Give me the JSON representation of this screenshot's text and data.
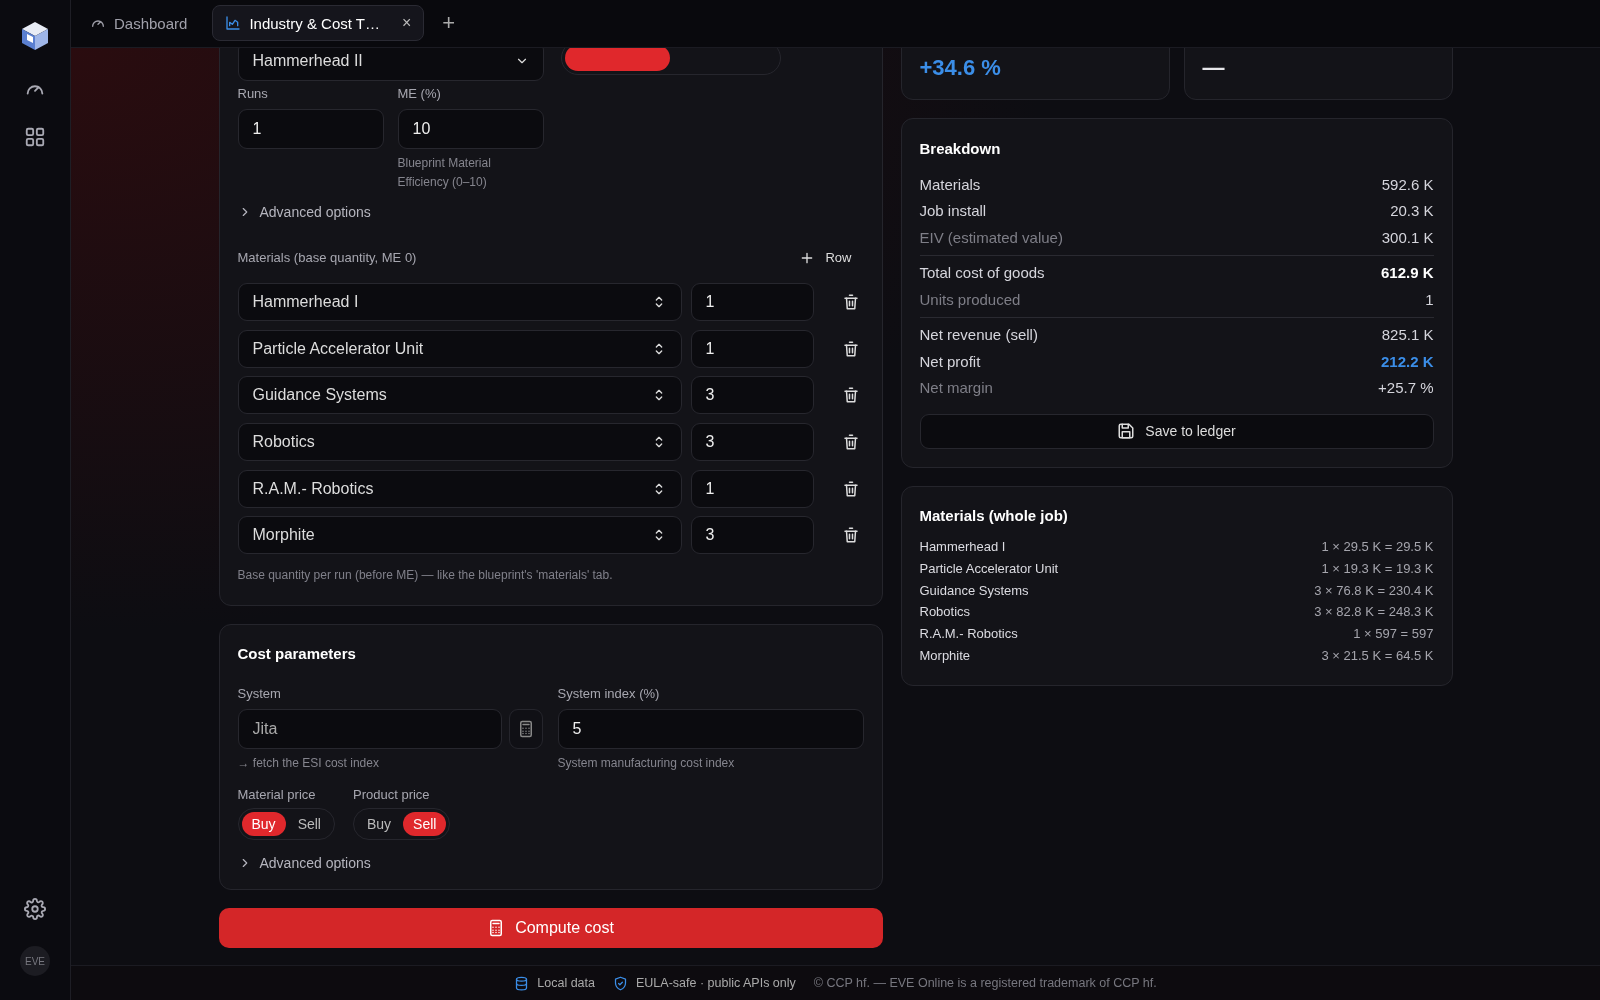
{
  "sidebar": {
    "avatar": "EVE"
  },
  "tabs": [
    {
      "label": "Dashboard",
      "selected": false
    },
    {
      "label": "Industry & Cost T…",
      "selected": true,
      "close": "×"
    }
  ],
  "new_tab": "+",
  "product": {
    "value": "Hammerhead II",
    "toggle": [
      {
        "selected": true
      },
      {
        "selected": false
      }
    ]
  },
  "runs": {
    "label": "Runs",
    "value": "1"
  },
  "me": {
    "label": "ME (%)",
    "value": "10",
    "hint": "Blueprint Material Efficiency (0–10)"
  },
  "advanced_1": "Advanced options",
  "materials_header": "Materials (base quantity, ME 0)",
  "add_row": "Row",
  "material_rows": [
    {
      "name": "Hammerhead I",
      "qty": "1"
    },
    {
      "name": "Particle Accelerator Unit",
      "qty": "1"
    },
    {
      "name": "Guidance Systems",
      "qty": "3"
    },
    {
      "name": "Robotics",
      "qty": "3"
    },
    {
      "name": "R.A.M.- Robotics",
      "qty": "1"
    },
    {
      "name": "Morphite",
      "qty": "3"
    }
  ],
  "materials_note": "Base quantity per run (before ME) — like the blueprint's 'materials' tab.",
  "cost_parameters": {
    "title": "Cost parameters",
    "system": {
      "label": "System",
      "placeholder": "Jita",
      "hint": "→ fetch the ESI cost index"
    },
    "system_index": {
      "label": "System index (%)",
      "value": "5",
      "hint": "System manufacturing cost index"
    },
    "material_price": {
      "label": "Material price",
      "options": [
        {
          "label": "Buy",
          "selected": true
        },
        {
          "label": "Sell",
          "selected": false
        }
      ]
    },
    "product_price": {
      "label": "Product price",
      "options": [
        {
          "label": "Buy",
          "selected": false
        },
        {
          "label": "Sell",
          "selected": true
        }
      ]
    },
    "advanced": "Advanced options"
  },
  "compute_button": "Compute cost",
  "stats": [
    {
      "value": "+34.6 %",
      "accent": true
    },
    {
      "value": "—",
      "accent": false
    }
  ],
  "breakdown": {
    "title": "Breakdown",
    "rows": [
      {
        "label": "Materials",
        "value": "592.6 K",
        "muted": false,
        "bold": false,
        "accent": false,
        "divider_before": false
      },
      {
        "label": "Job install",
        "value": "20.3 K",
        "muted": false,
        "bold": false,
        "accent": false,
        "divider_before": false
      },
      {
        "label": "EIV (estimated value)",
        "value": "300.1 K",
        "muted": true,
        "bold": false,
        "accent": false,
        "divider_before": false
      },
      {
        "label": "Total cost of goods",
        "value": "612.9 K",
        "muted": false,
        "bold": true,
        "accent": false,
        "divider_before": true
      },
      {
        "label": "Units produced",
        "value": "1",
        "muted": true,
        "bold": false,
        "accent": false,
        "divider_before": false
      },
      {
        "label": "Net revenue (sell)",
        "value": "825.1 K",
        "muted": false,
        "bold": false,
        "accent": false,
        "divider_before": true
      },
      {
        "label": "Net profit",
        "value": "212.2 K",
        "muted": false,
        "bold": false,
        "accent": true,
        "divider_before": false
      },
      {
        "label": "Net margin",
        "value": "+25.7 %",
        "muted": true,
        "bold": false,
        "accent": false,
        "divider_before": false
      }
    ],
    "save_button": "Save to ledger"
  },
  "materials_job": {
    "title": "Materials (whole job)",
    "rows": [
      {
        "name": "Hammerhead I",
        "calc": "1 × 29.5 K = 29.5 K"
      },
      {
        "name": "Particle Accelerator Unit",
        "calc": "1 × 19.3 K = 19.3 K"
      },
      {
        "name": "Guidance Systems",
        "calc": "3 × 76.8 K = 230.4 K"
      },
      {
        "name": "Robotics",
        "calc": "3 × 82.8 K = 248.3 K"
      },
      {
        "name": "R.A.M.- Robotics",
        "calc": "1 × 597 = 597"
      },
      {
        "name": "Morphite",
        "calc": "3 × 21.5 K = 64.5 K"
      }
    ]
  },
  "footer": [
    {
      "kind": "database",
      "text": "Local data"
    },
    {
      "kind": "shield",
      "text": "EULA-safe · public APIs only"
    },
    {
      "kind": "plain",
      "text": "© CCP hf. — EVE Online is a registered trademark of CCP hf."
    }
  ]
}
